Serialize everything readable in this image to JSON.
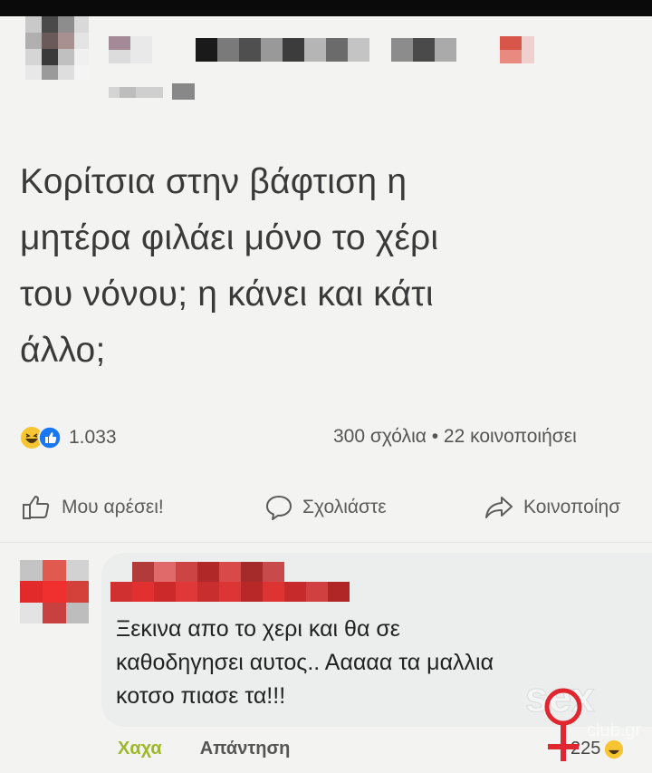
{
  "post": {
    "text": "Κορίτσια στην βάφτιση η\nμητέρα φιλάει μόνο το χέρι\nτου νόνου; η κάνει και κάτι\nάλλο;",
    "reaction_count": "1.033",
    "counts_text": "300 σχόλια • 22 κοινοποιήσει",
    "reaction_icons": [
      "haha-icon",
      "like-icon"
    ]
  },
  "actions": {
    "like_label": "Μου αρέσει!",
    "comment_label": "Σχολιάστε",
    "share_label": "Κοινοποίησ"
  },
  "comment": {
    "text": "Ξεκινα απο το χερι και θα σε\nκαθοδηγησει αυτος.. Ααααα τα μαλλια\nκοτσο πιασε τα!!!",
    "haha_label": "Χαχα",
    "reply_label": "Απάντηση",
    "reaction_count": "225"
  },
  "watermark": {
    "text": "sex",
    "sub": "club.gr"
  },
  "colors": {
    "background": "#f3f4f2",
    "haha_green": "#9fb72b",
    "like_blue": "#1877f2",
    "watermark_red": "#e0262f"
  }
}
